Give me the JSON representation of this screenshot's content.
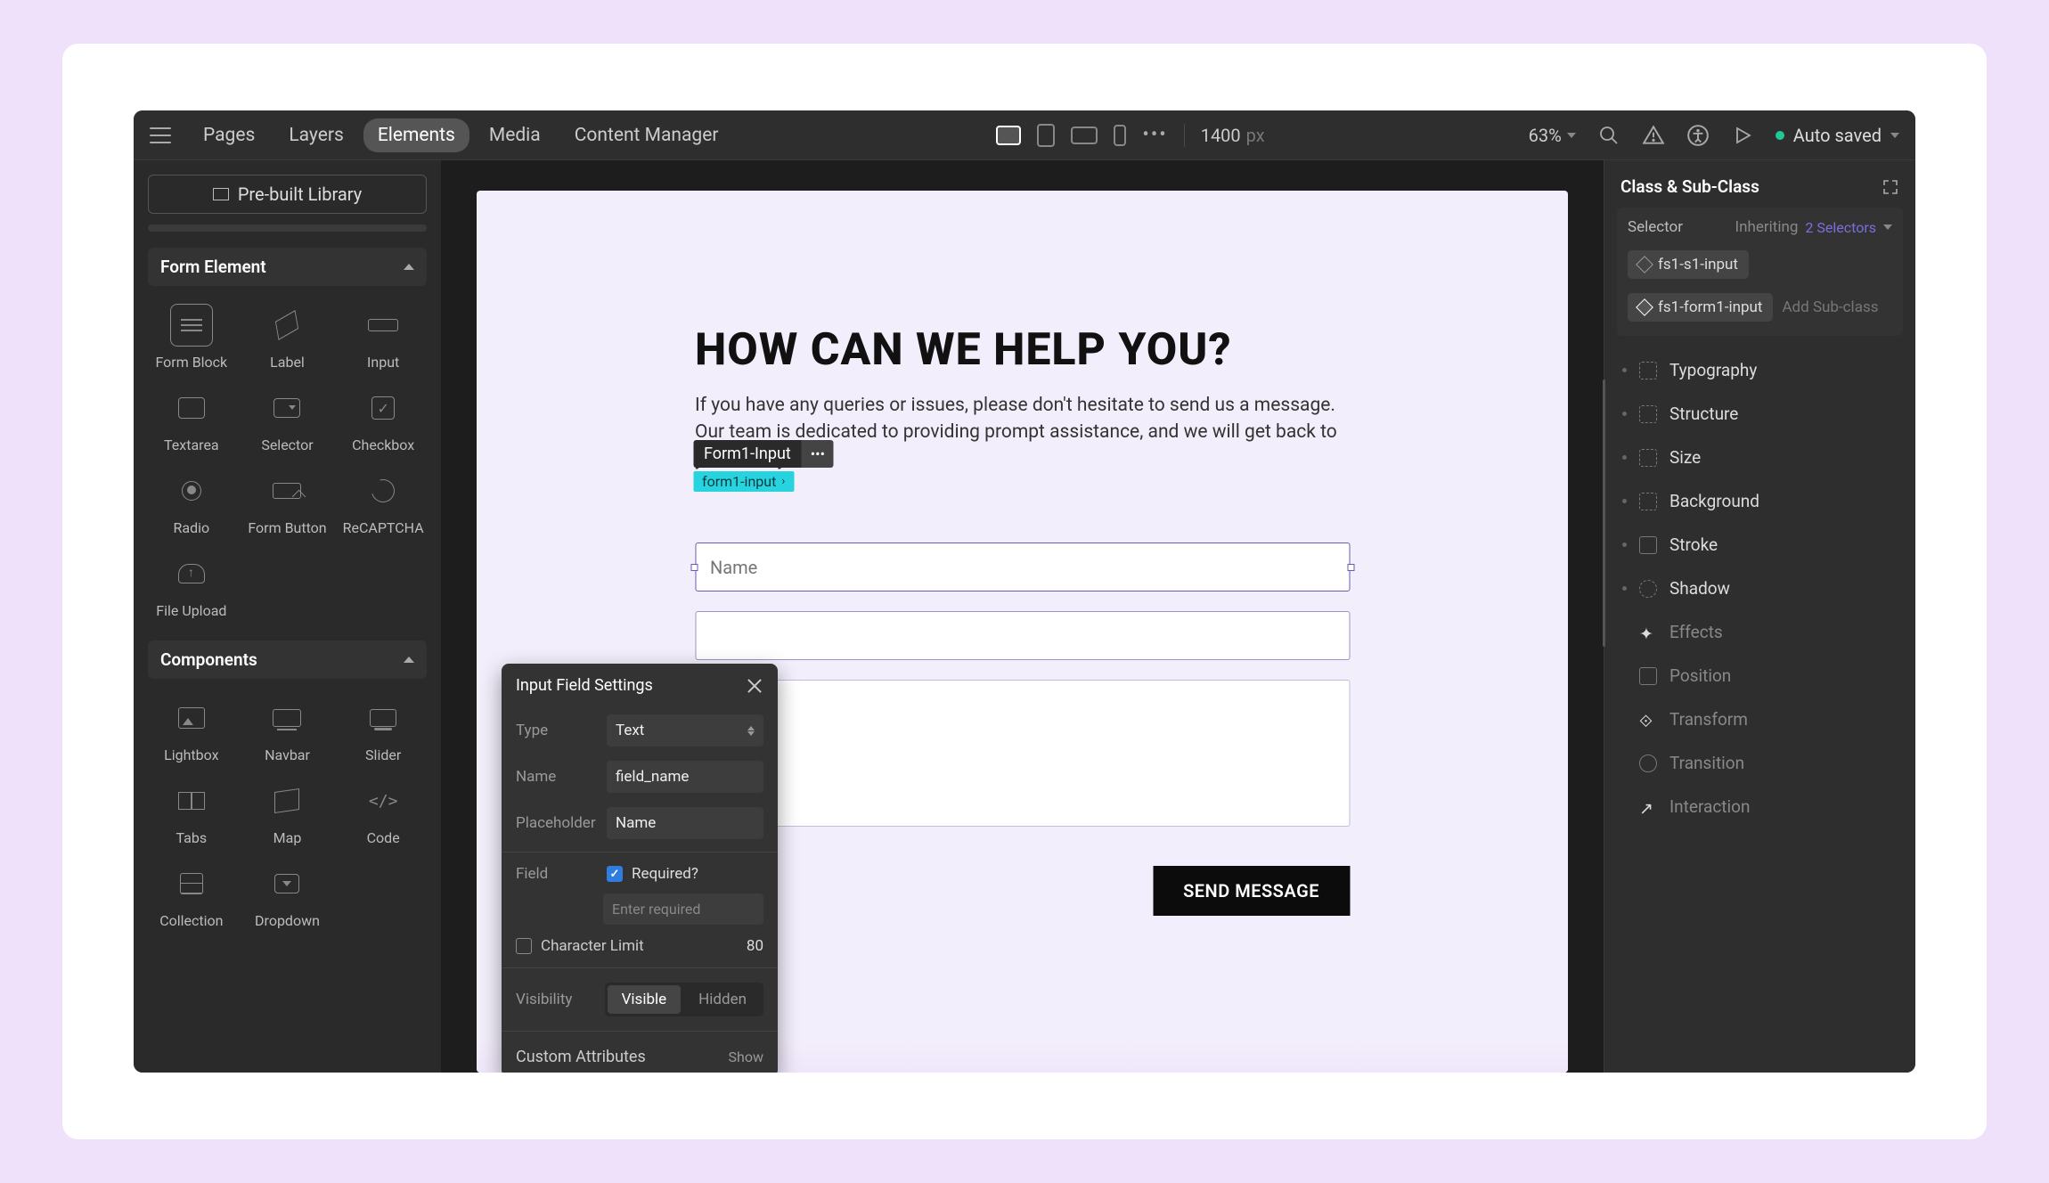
{
  "topnav": {
    "pages": "Pages",
    "layers": "Layers",
    "elements": "Elements",
    "media": "Media",
    "content_manager": "Content Manager"
  },
  "canvas_width": "1400",
  "canvas_unit": "px",
  "zoom": "63%",
  "autosave": "Auto saved",
  "left": {
    "prebuilt": "Pre-built Library",
    "form_element_hdr": "Form Element",
    "components_hdr": "Components",
    "items": {
      "form_block": "Form Block",
      "label": "Label",
      "input": "Input",
      "textarea": "Textarea",
      "selector": "Selector",
      "checkbox": "Checkbox",
      "radio": "Radio",
      "form_button": "Form Button",
      "recaptcha": "ReCAPTCHA",
      "file_upload": "File Upload",
      "lightbox": "Lightbox",
      "navbar": "Navbar",
      "slider": "Slider",
      "tabs": "Tabs",
      "map": "Map",
      "code": "Code",
      "collection": "Collection",
      "dropdown": "Dropdown"
    }
  },
  "canvas": {
    "title": "HOW CAN WE HELP YOU?",
    "desc": "If you have any queries or issues, please don't hesitate to send us a message. Our team is dedicated to providing prompt assistance, and we will get back to you shortly.",
    "sel_tag1": "Form1-Input",
    "sel_tag2": "form1-input",
    "input1_placeholder": "Name",
    "send_btn": "SEND MESSAGE"
  },
  "settings": {
    "title": "Input Field Settings",
    "type_lbl": "Type",
    "type_val": "Text",
    "name_lbl": "Name",
    "name_val": "field_name",
    "placeholder_lbl": "Placeholder",
    "placeholder_val": "Name",
    "field_lbl": "Field",
    "required_lbl": "Required?",
    "required_placeholder": "Enter required",
    "charlimit_lbl": "Character Limit",
    "charlimit_val": "80",
    "visibility_lbl": "Visibility",
    "vis_visible": "Visible",
    "vis_hidden": "Hidden",
    "custom_attr": "Custom Attributes",
    "show": "Show"
  },
  "right": {
    "class_hdr": "Class & Sub-Class",
    "selector_lbl": "Selector",
    "inheriting_lbl": "Inheriting",
    "inheriting_count": "2 Selectors",
    "chip1": "fs1-s1-input",
    "chip2": "fs1-form1-input",
    "add_sub": "Add Sub-class",
    "styles": {
      "typography": "Typography",
      "structure": "Structure",
      "size": "Size",
      "background": "Background",
      "stroke": "Stroke",
      "shadow": "Shadow",
      "effects": "Effects",
      "position": "Position",
      "transform": "Transform",
      "transition": "Transition",
      "interaction": "Interaction"
    }
  }
}
